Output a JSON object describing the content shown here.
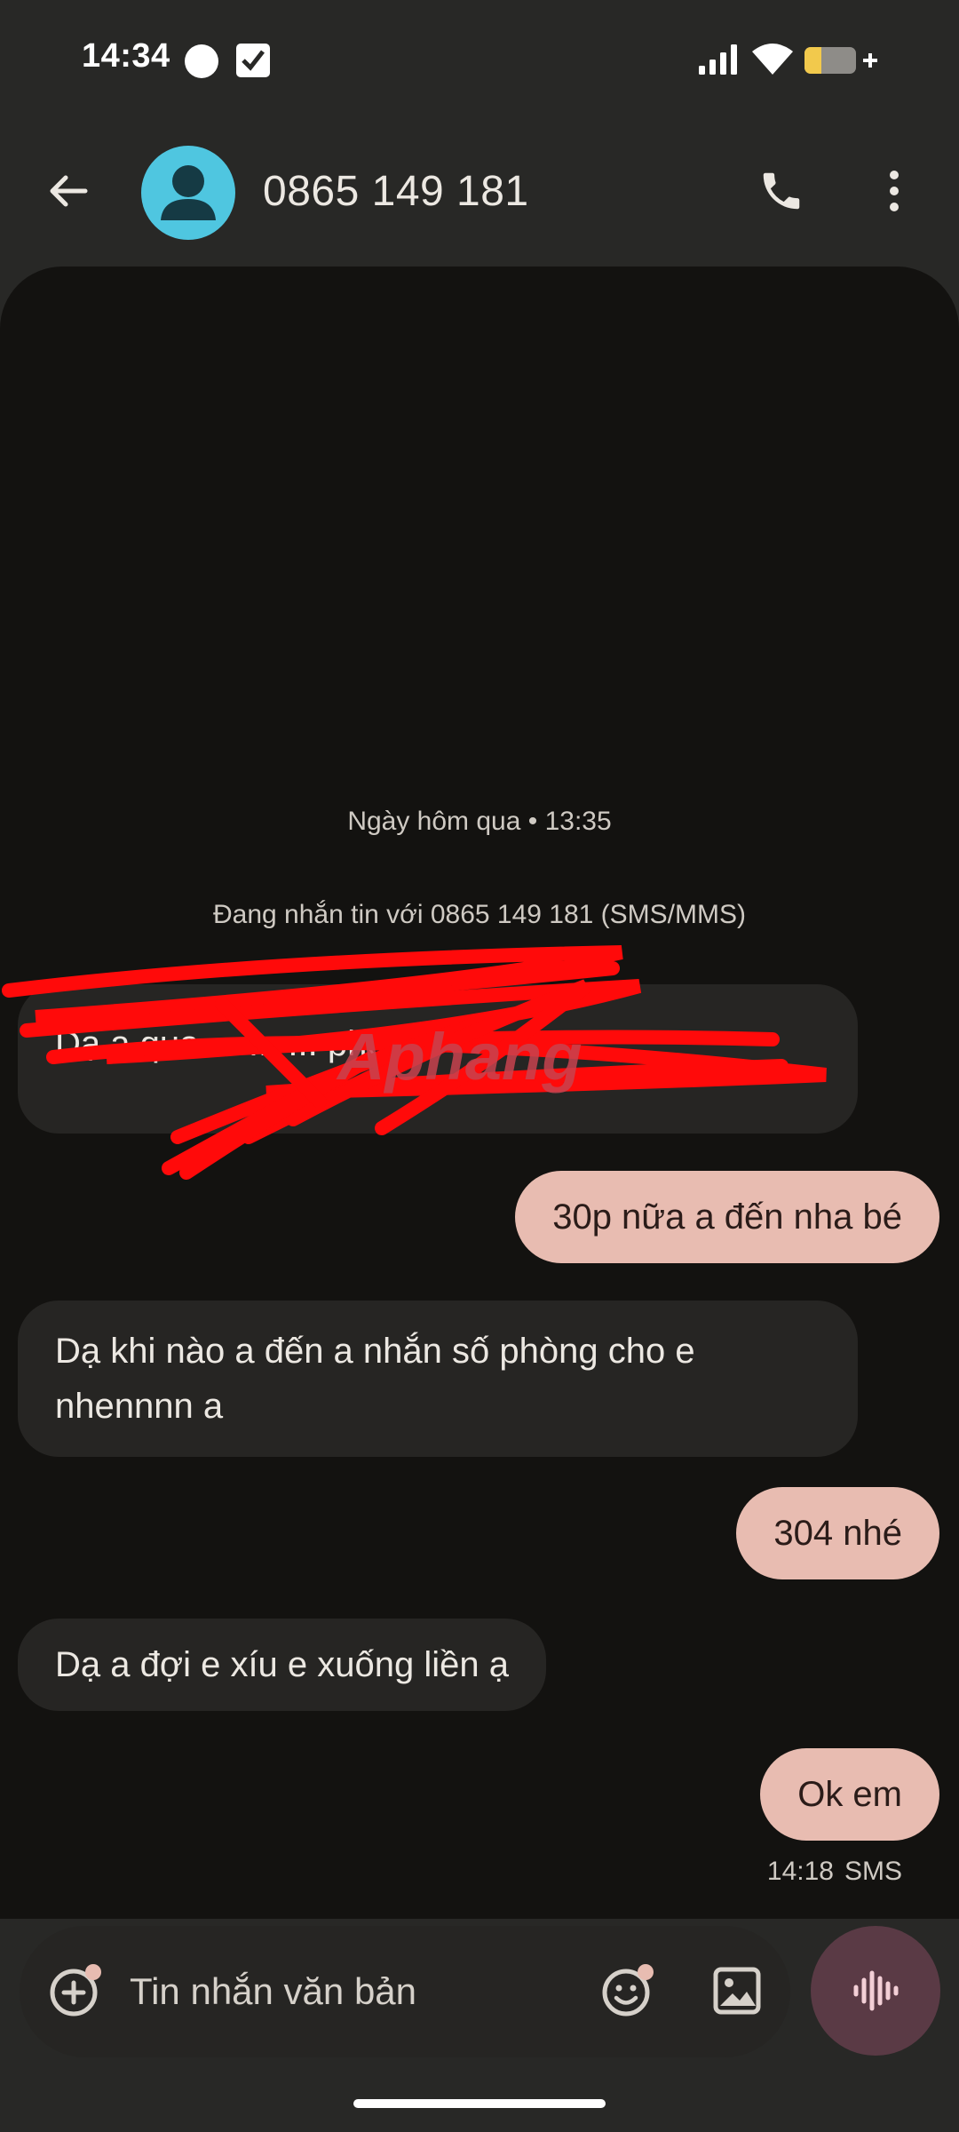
{
  "status_bar": {
    "time": "14:34"
  },
  "header": {
    "contact_name": "0865 149 181",
    "back_icon": "arrow-left-icon",
    "call_icon": "phone-icon",
    "more_icon": "more-vertical-icon",
    "avatar_color": "#4fc6e0"
  },
  "conversation": {
    "date_separator": "Ngày hôm qua • 13:35",
    "info": "Đang nhắn tin với 0865 149 181 (SMS/MMS)",
    "messages": [
      {
        "direction": "incoming",
        "text": "Dạ a qua ... ... ... phòng",
        "redacted": true
      },
      {
        "direction": "outgoing",
        "text": "30p nữa a đến nha bé"
      },
      {
        "direction": "incoming",
        "text": "Dạ khi nào a đến a nhắn số phòng cho e nhennnn a"
      },
      {
        "direction": "outgoing",
        "text": "304 nhé"
      },
      {
        "direction": "incoming",
        "text": "Dạ a đợi e xíu e xuống liền ạ"
      },
      {
        "direction": "outgoing",
        "text": "Ok em"
      }
    ],
    "last_time": "14:18",
    "last_type": "SMS",
    "watermark": "Aphang"
  },
  "compose": {
    "placeholder": "Tin nhắn văn bản",
    "attach_icon": "add-circle-icon",
    "emoji_icon": "emoji-icon",
    "gallery_icon": "image-icon",
    "voice_icon": "voice-wave-icon"
  },
  "colors": {
    "background": "#282826",
    "conversation_bg": "#131210",
    "incoming_bubble": "#262523",
    "outgoing_bubble": "#e8bcb1",
    "voice_button": "#5a3a45"
  }
}
